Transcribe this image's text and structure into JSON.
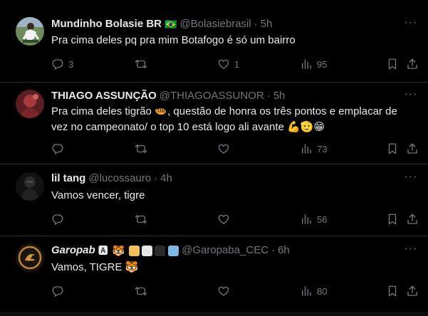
{
  "theme": {
    "background": "#000000",
    "text": "#e7e9ea",
    "muted": "#71767b",
    "divider": "#2f3336"
  },
  "tweets": [
    {
      "name": "Mundinho Bolasie BR",
      "name_emoji": "🇧🇷",
      "handle": "@Bolasiebrasil",
      "separator": "·",
      "time": "5h",
      "text": "Pra cima deles pq pra mim Botafogo é só um bairro",
      "replies": "3",
      "retweets": "",
      "likes": "1",
      "views": "95",
      "avatar_icon": "football-player-avatar"
    },
    {
      "name": "THIAGO ASSUNÇÃO",
      "handle": "@THIAGOASSUNOR",
      "separator": "·",
      "time": "5h",
      "text_line1_before": "Pra cima deles tigrão ",
      "text_line1_after": ", questão de honra os três pontos e emplacar de",
      "text_line2": "vez no campeonato/ o top 10 está logo ali avante ",
      "text_line2_emojis": "💪🫡😁",
      "replies": "",
      "retweets": "",
      "likes": "",
      "views": "73",
      "avatar_icon": "red-portrait-avatar"
    },
    {
      "name": "lil tang",
      "handle": "@lucossauro",
      "separator": "·",
      "time": "4h",
      "text": "Vamos vencer, tigre",
      "replies": "",
      "retweets": "",
      "likes": "",
      "views": "56",
      "avatar_icon": "dark-figure-avatar"
    },
    {
      "name": "Garopab",
      "name_badge_emoji": "🅰",
      "name_tiger_emoji": "🐯",
      "handle": "@Garopaba_CEC",
      "separator": "·",
      "time": "6h",
      "text": "Vamos, TIGRE ",
      "text_emoji": "🐯",
      "replies": "",
      "retweets": "",
      "likes": "",
      "views": "80",
      "avatar_icon": "tiger-crest-avatar"
    }
  ],
  "icons": {
    "reply": "reply-icon",
    "retweet": "retweet-icon",
    "like": "heart-icon",
    "views": "views-icon",
    "bookmark": "bookmark-icon",
    "share": "share-icon",
    "more": "more-icon"
  }
}
